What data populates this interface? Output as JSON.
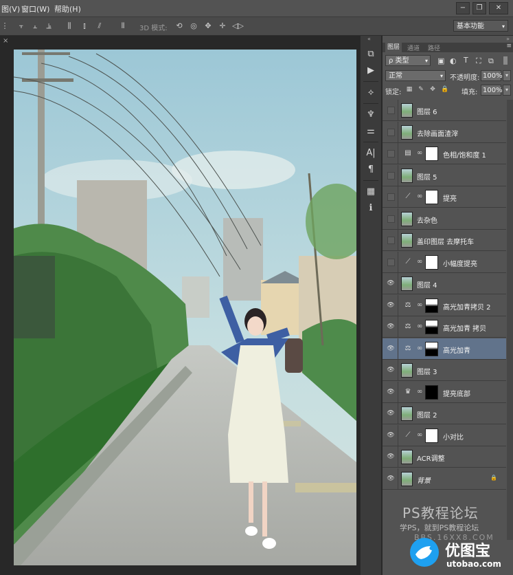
{
  "menubar": {
    "items": [
      "图(V)",
      "窗口(W)",
      "帮助(H)"
    ],
    "window_controls": [
      "minimize",
      "restore",
      "close"
    ]
  },
  "options_bar": {
    "mode_3d_label": "3D 模式:",
    "workspace": "基本功能"
  },
  "document": {
    "close_glyph": "×"
  },
  "layers_panel": {
    "tabs": [
      "图层",
      "通道",
      "路径"
    ],
    "active_tab": "图层",
    "filter_type": "ρ 类型",
    "blend_mode": "正常",
    "opacity_label": "不透明度:",
    "opacity_value": "100%",
    "lock_label": "锁定:",
    "fill_label": "填充:",
    "fill_value": "100%",
    "layers": [
      {
        "name": "图层 6",
        "visible": false,
        "kind": "pixel"
      },
      {
        "name": "去除画面渣滓",
        "visible": false,
        "kind": "pixel"
      },
      {
        "name": "色相/饱和度 1",
        "visible": false,
        "kind": "hue",
        "mask": "white"
      },
      {
        "name": "图层 5",
        "visible": false,
        "kind": "pixel"
      },
      {
        "name": "提亮",
        "visible": false,
        "kind": "curves",
        "mask": "white"
      },
      {
        "name": "去杂色",
        "visible": false,
        "kind": "pixel"
      },
      {
        "name": "盖印图层 去摩托车",
        "visible": false,
        "kind": "pixel"
      },
      {
        "name": "小幅度提亮",
        "visible": false,
        "kind": "curves",
        "mask": "white"
      },
      {
        "name": "图层 4",
        "visible": true,
        "kind": "pixel"
      },
      {
        "name": "高光加青拷贝 2",
        "visible": true,
        "kind": "balance",
        "mask": "partial"
      },
      {
        "name": "高光加青 拷贝",
        "visible": true,
        "kind": "balance",
        "mask": "partial"
      },
      {
        "name": "高光加青",
        "visible": true,
        "kind": "balance",
        "mask": "partial",
        "selected": true
      },
      {
        "name": "图层 3",
        "visible": true,
        "kind": "pixel"
      },
      {
        "name": "提亮底部",
        "visible": true,
        "kind": "levels",
        "mask": "black"
      },
      {
        "name": "图层 2",
        "visible": true,
        "kind": "pixel"
      },
      {
        "name": "小对比",
        "visible": true,
        "kind": "curves",
        "mask": "white"
      },
      {
        "name": "ACR调整",
        "visible": true,
        "kind": "pixel"
      },
      {
        "name": "背景",
        "visible": true,
        "kind": "pixel",
        "locked": true,
        "italic": true
      }
    ]
  },
  "watermark": {
    "title": "PS教程论坛",
    "subtitle": "学PS，就到PS教程论坛",
    "url": "BBS.16XX8.COM",
    "logo_text": "优图宝",
    "logo_url": "utobao.com"
  },
  "colors": {
    "selected_layer": "#61738b",
    "panel_bg": "#535353",
    "logo_blue": "#1ea0f0"
  }
}
